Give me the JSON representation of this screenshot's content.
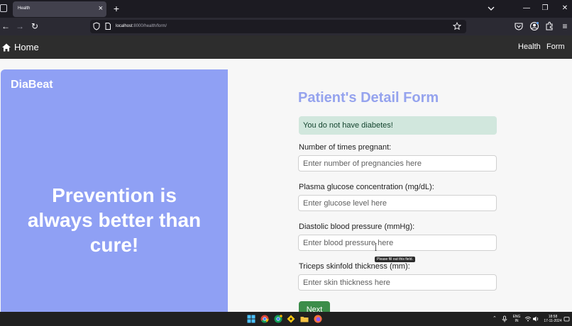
{
  "browser": {
    "tab": {
      "title": "Health"
    },
    "url": {
      "host": "localhost",
      "path": ":8000/health/form/"
    }
  },
  "site": {
    "brand": "Home",
    "nav": [
      {
        "label": "Health"
      },
      {
        "label": "Form"
      }
    ]
  },
  "left_panel": {
    "title": "DiaBeat",
    "slogan_lines": [
      "Prevention is",
      "always better than",
      "cure!"
    ]
  },
  "form": {
    "title": "Patient's Detail Form",
    "alert": "You do not have diabetes!",
    "fields": [
      {
        "label": "Number of times pregnant:",
        "placeholder": "Enter number of pregnancies here"
      },
      {
        "label": "Plasma glucose concentration (mg/dL):",
        "placeholder": "Enter glucose level here"
      },
      {
        "label": "Diastolic blood pressure (mmHg):",
        "placeholder": "Enter blood pressure here"
      },
      {
        "label": "Triceps skinfold thickness (mm):",
        "placeholder": "Enter skin thickness here"
      }
    ],
    "tooltip": "Please fill out this field.",
    "next_label": "Next"
  },
  "taskbar": {
    "lang": [
      "ENG",
      "IN"
    ],
    "time": "18:58",
    "date": "17-11-2024"
  },
  "colors": {
    "panel": "#8fa0f4",
    "title": "#95a3ee",
    "alert_bg": "#d1e7dd",
    "next_button": "#3c8d4a"
  }
}
